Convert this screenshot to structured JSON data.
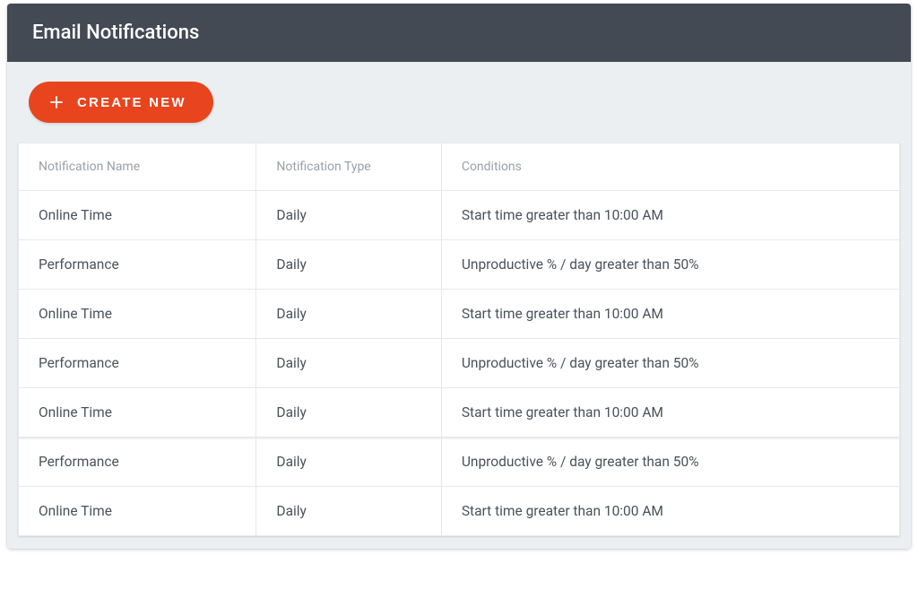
{
  "header": {
    "title": "Email Notifications"
  },
  "toolbar": {
    "create_label": "CREATE NEW"
  },
  "table": {
    "columns": {
      "name": "Notification Name",
      "type": "Notification Type",
      "conditions": "Conditions"
    },
    "rows": [
      {
        "name": "Online Time",
        "type": "Daily",
        "conditions": "Start time greater than 10:00 AM"
      },
      {
        "name": "Performance",
        "type": "Daily",
        "conditions": "Unproductive % / day greater than 50%"
      },
      {
        "name": "Online Time",
        "type": "Daily",
        "conditions": "Start time greater than 10:00 AM"
      },
      {
        "name": "Performance",
        "type": "Daily",
        "conditions": "Unproductive % / day greater than 50%"
      },
      {
        "name": "Online Time",
        "type": "Daily",
        "conditions": "Start time greater than 10:00 AM"
      },
      {
        "name": "Performance",
        "type": "Daily",
        "conditions": "Unproductive % / day greater than 50%"
      },
      {
        "name": "Online Time",
        "type": "Daily",
        "conditions": "Start time greater than 10:00 AM"
      }
    ]
  }
}
